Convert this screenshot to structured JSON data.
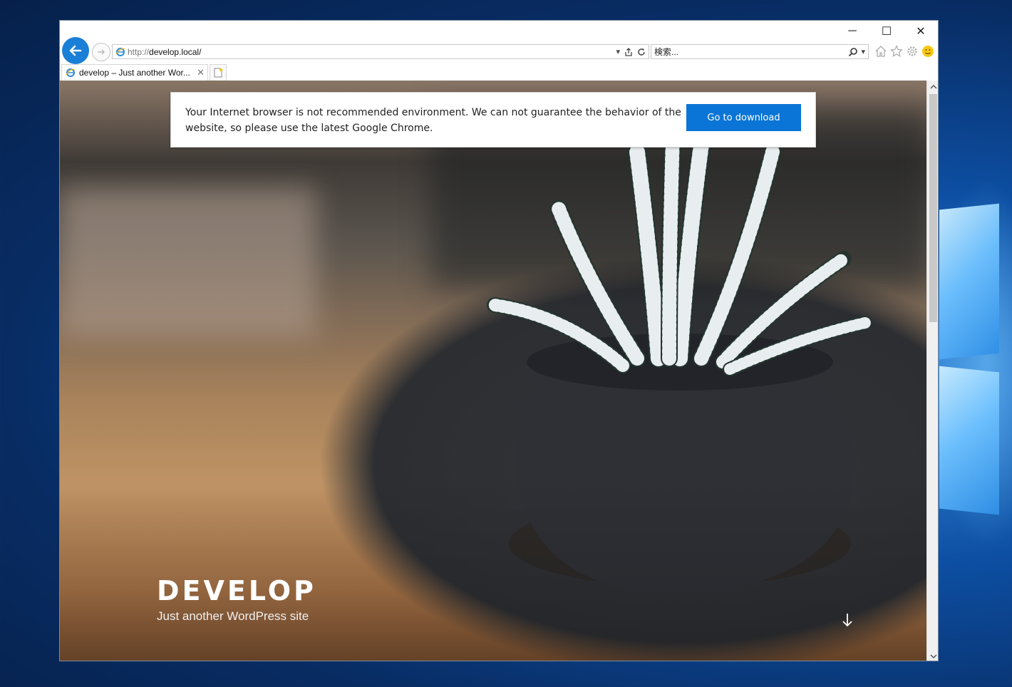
{
  "browser": {
    "address": {
      "protocol": "http://",
      "host": "develop.local/"
    },
    "search": {
      "placeholder": "検索..."
    },
    "tab": {
      "title": "develop – Just another Wor..."
    },
    "window_controls": {
      "minimize": "─",
      "maximize": "☐",
      "close": "✕"
    },
    "icons": [
      "back-icon",
      "forward-icon",
      "ie-icon",
      "dropdown-icon",
      "share-icon",
      "refresh-icon",
      "search-icon",
      "home-icon",
      "favorites-star-icon",
      "settings-gear-icon",
      "smiley-feedback-icon",
      "tab-close-icon",
      "new-tab-icon"
    ]
  },
  "page": {
    "notice": {
      "message": "Your Internet browser is not recommended environment. We can not guarantee the behavior of the website, so please use the latest Google Chrome.",
      "button_label": "Go to download"
    },
    "site_title": "DEVELOP",
    "tagline": "Just another WordPress site",
    "scroll_arrow": "↓"
  },
  "colors": {
    "accent_blue": "#0a75d6",
    "back_button": "#1a7fd6"
  }
}
